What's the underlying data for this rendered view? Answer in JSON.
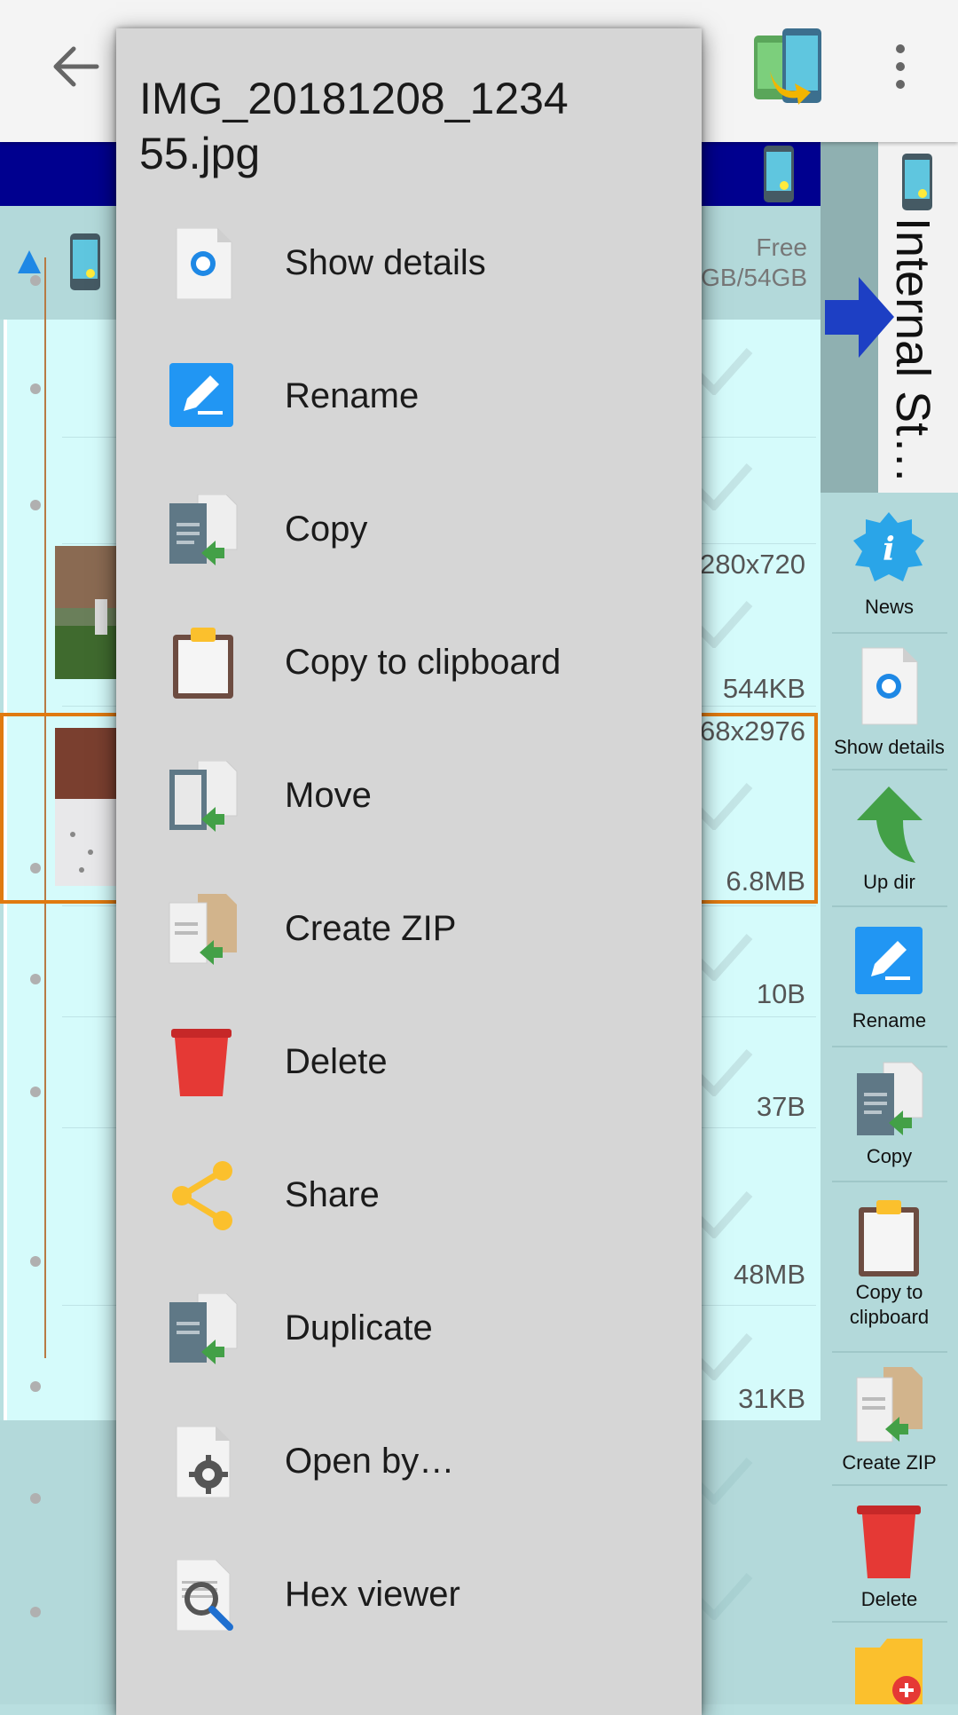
{
  "toolbar": {
    "back_icon": "arrow-left-icon",
    "transfer_icon": "device-transfer-icon",
    "menu_icon": "more-vert-icon"
  },
  "volume": {
    "free_label": "Free",
    "free_value": "GB/54GB"
  },
  "file_rows": [
    {
      "meta_top": "",
      "meta_bottom": ""
    },
    {
      "meta_top": "",
      "meta_bottom": ""
    },
    {
      "meta_top": "280x720",
      "meta_bottom": "544KB"
    },
    {
      "meta_top": "68x2976",
      "meta_bottom": "6.8MB"
    },
    {
      "meta_top": "",
      "meta_bottom": "10B"
    },
    {
      "meta_top": "",
      "meta_bottom": "37B"
    },
    {
      "meta_top": "",
      "meta_bottom": "48MB"
    },
    {
      "meta_top": "",
      "meta_bottom": "31KB"
    }
  ],
  "side_panel": {
    "tab_label": "Internal St…",
    "buttons": [
      {
        "label": "News",
        "icon": "news-info-icon"
      },
      {
        "label": "Show details",
        "icon": "details-icon"
      },
      {
        "label": "Up dir",
        "icon": "up-arrow-icon"
      },
      {
        "label": "Rename",
        "icon": "rename-icon"
      },
      {
        "label": "Copy",
        "icon": "copy-icon"
      },
      {
        "label": "Copy to\nclipboard",
        "label_line1": "Copy to",
        "label_line2": "clipboard",
        "icon": "clipboard-icon"
      },
      {
        "label": "Create ZIP",
        "icon": "zip-icon"
      },
      {
        "label": "Delete",
        "icon": "trash-icon"
      },
      {
        "label": "",
        "icon": "new-folder-icon"
      }
    ]
  },
  "popup": {
    "title": "IMG_20181208_123455.jpg",
    "title_line1": "IMG_20181208_1234",
    "title_line2": "55.jpg",
    "items": [
      {
        "label": "Show details",
        "icon": "details-icon"
      },
      {
        "label": "Rename",
        "icon": "rename-icon"
      },
      {
        "label": "Copy",
        "icon": "copy-icon"
      },
      {
        "label": "Copy to clipboard",
        "icon": "clipboard-icon"
      },
      {
        "label": "Move",
        "icon": "move-icon"
      },
      {
        "label": "Create ZIP",
        "icon": "zip-icon"
      },
      {
        "label": "Delete",
        "icon": "trash-icon"
      },
      {
        "label": "Share",
        "icon": "share-icon"
      },
      {
        "label": "Duplicate",
        "icon": "duplicate-icon"
      },
      {
        "label": "Open by…",
        "icon": "open-with-gear-icon"
      },
      {
        "label": "Hex viewer",
        "icon": "hex-viewer-icon"
      }
    ]
  },
  "colors": {
    "path_bar": "#00008f",
    "selection_border": "#e07a10",
    "list_bg": "#d5fbfb",
    "popup_bg": "#d6d6d6"
  }
}
